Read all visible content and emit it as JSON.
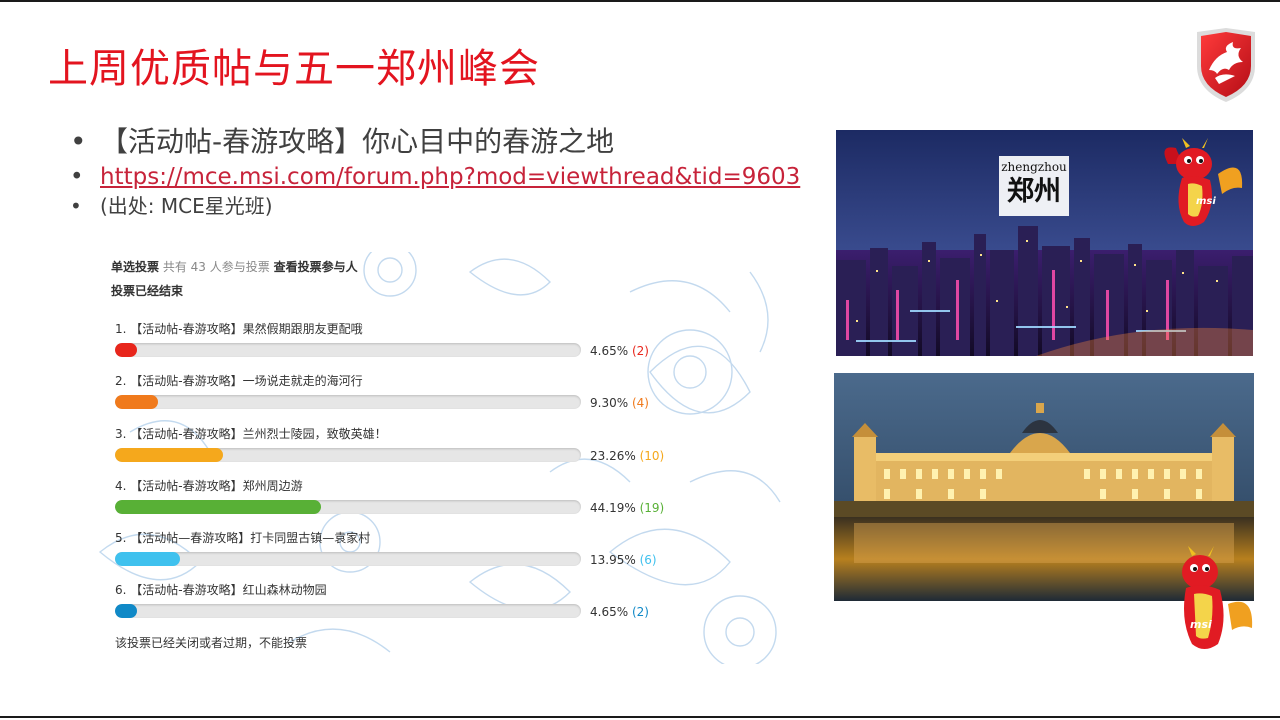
{
  "slide": {
    "title": "上周优质帖与五一郑州峰会"
  },
  "bullets": {
    "item1": "【活动帖-春游攻略】你心目中的春游之地",
    "link": "https://mce.msi.com/forum.php?mod=viewthread&tid=9603",
    "source": "(出处: MCE星光班)"
  },
  "poll": {
    "type_label": "单选投票",
    "participants_text": "共有 43 人参与投票",
    "view_voters_link": "查看投票参与人",
    "closed_label": "投票已经结束",
    "options": [
      {
        "label": "1. 【活动帖-春游攻略】果然假期跟朋友更配哦",
        "percent": 4.65,
        "percent_text": "4.65%",
        "votes_text": "(2)",
        "color": "#e8261c"
      },
      {
        "label": "2. 【活动贴-春游攻略】一场说走就走的海河行",
        "percent": 9.3,
        "percent_text": "9.30%",
        "votes_text": "(4)",
        "color": "#f07a1c"
      },
      {
        "label": "3. 【活动帖-春游攻略】兰州烈士陵园，致敬英雄！",
        "percent": 23.26,
        "percent_text": "23.26%",
        "votes_text": "(10)",
        "color": "#f5a81c"
      },
      {
        "label": "4. 【活动帖-春游攻略】郑州周边游",
        "percent": 44.19,
        "percent_text": "44.19%",
        "votes_text": "(19)",
        "color": "#58b036"
      },
      {
        "label": "5. 【活动帖—春游攻略】打卡同盟古镇—袁家村",
        "percent": 13.95,
        "percent_text": "13.95%",
        "votes_text": "(6)",
        "color": "#3fc1ee"
      },
      {
        "label": "6. 【活动帖-春游攻略】红山森林动物园",
        "percent": 4.65,
        "percent_text": "4.65%",
        "votes_text": "(2)",
        "color": "#1089c7"
      }
    ],
    "footer_note": "该投票已经关闭或者过期，不能投票"
  },
  "photos": {
    "zhengzhou_sign_pinyin": "zhengzhou",
    "zhengzhou_sign_hanzi": "郑州",
    "mascot_brand_text": "msi"
  },
  "colors": {
    "title_red": "#e3141f",
    "link_red": "#c7233a",
    "msi_red": "#d8121f"
  }
}
